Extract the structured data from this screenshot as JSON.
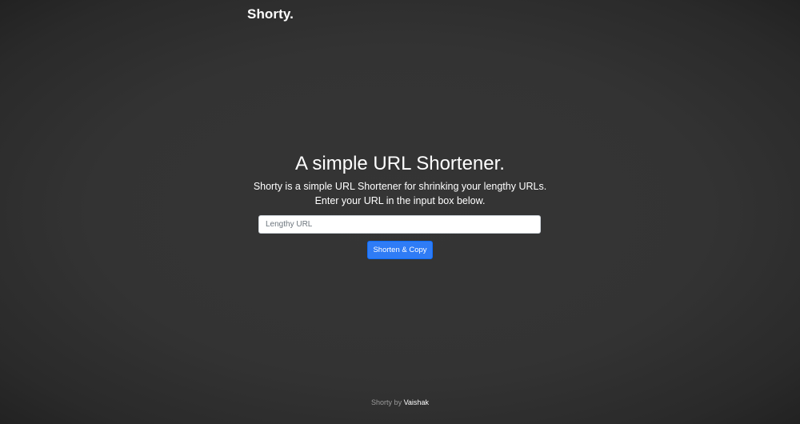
{
  "header": {
    "brand": "Shorty."
  },
  "hero": {
    "title": "A simple URL Shortener.",
    "line1": "Shorty is a simple URL Shortener for shrinking your lengthy URLs.",
    "line2": "Enter your URL in the input box below."
  },
  "form": {
    "url_placeholder": "Lengthy URL",
    "url_value": "",
    "submit_label": "Shorten & Copy"
  },
  "footer": {
    "prefix": "Shorty by",
    "author": "Vaishak"
  },
  "colors": {
    "background": "#333333",
    "button": "#2f7cf6",
    "text": "#ffffff"
  }
}
